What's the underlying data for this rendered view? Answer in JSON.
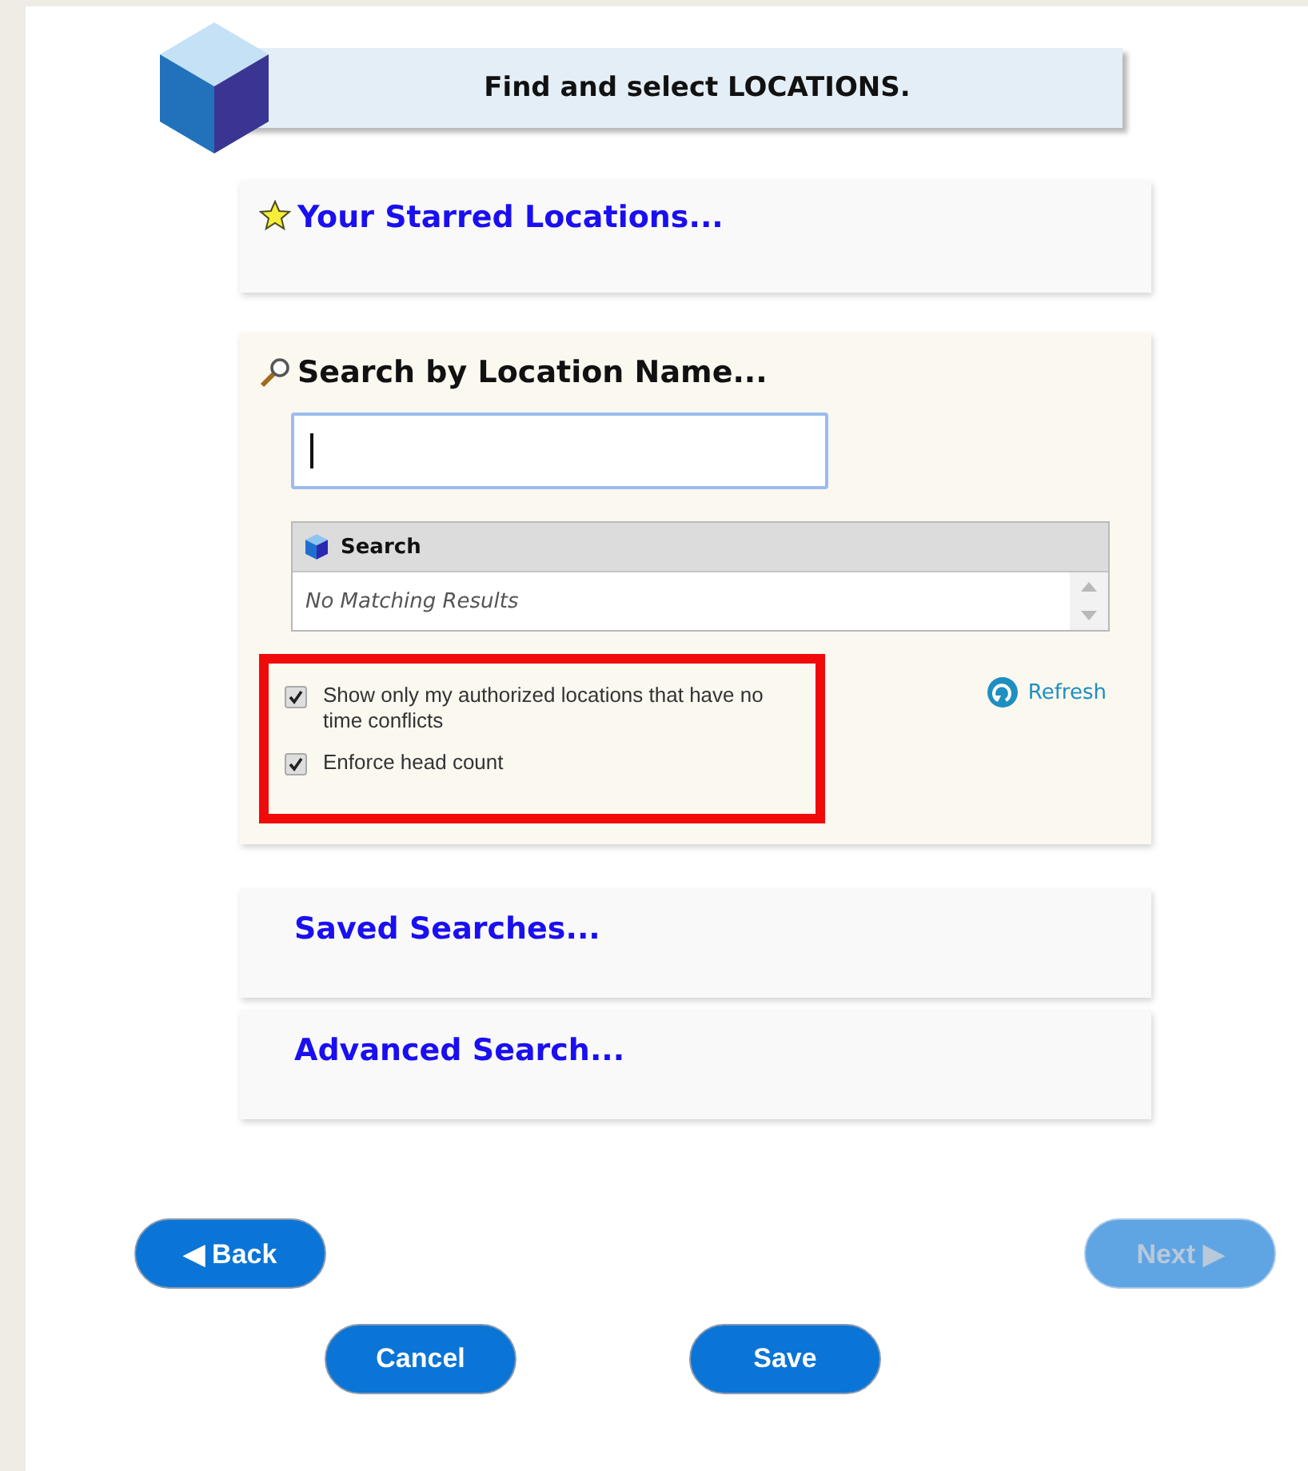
{
  "header": {
    "title": "Find and select LOCATIONS."
  },
  "starred": {
    "label": "Your Starred Locations..."
  },
  "search_panel": {
    "title": "Search by Location Name...",
    "input": {
      "focused": true
    },
    "results": {
      "header": "Search",
      "empty_text": "No Matching Results"
    },
    "options": [
      {
        "label": "Show only my authorized locations that have no time conflicts",
        "checked": true
      },
      {
        "label": "Enforce head count",
        "checked": true
      }
    ],
    "refresh": "Refresh"
  },
  "sections": [
    {
      "label": "Saved Searches..."
    },
    {
      "label": "Advanced Search..."
    }
  ],
  "nav_buttons": [
    {
      "label": "◀ Back",
      "disabled": false
    },
    {
      "label": "Next ▶",
      "disabled": true
    }
  ],
  "action_buttons": [
    {
      "label": "Cancel",
      "disabled": false
    },
    {
      "label": "Save",
      "disabled": false
    }
  ]
}
